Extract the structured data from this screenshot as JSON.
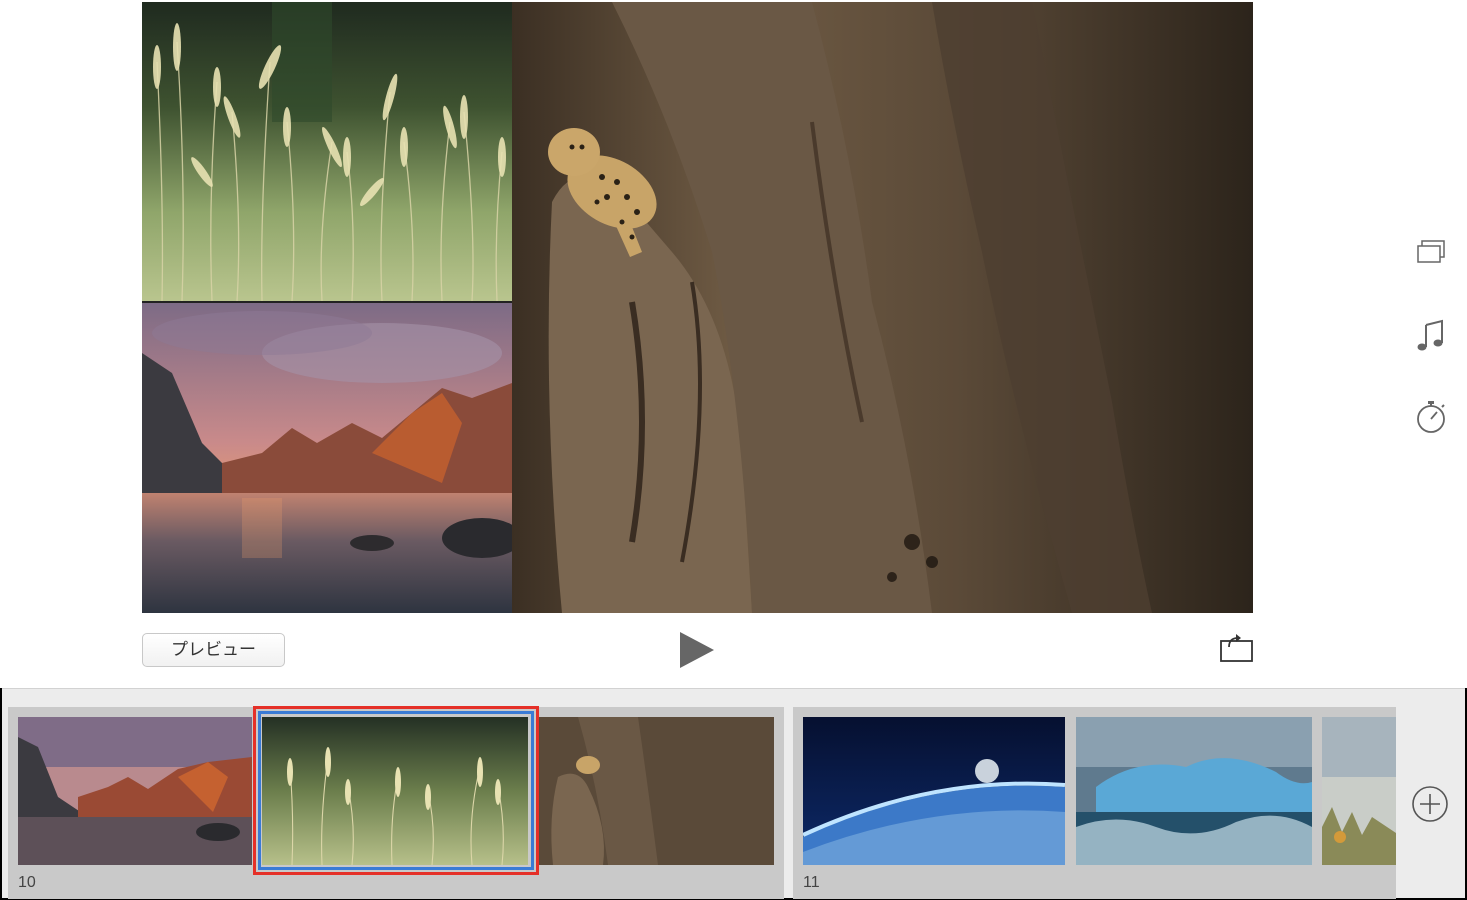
{
  "viewer": {
    "photos": [
      "grass-photo",
      "fjord-sunset-photo",
      "leopard-tree-photo"
    ],
    "preview_label": "プレビュー"
  },
  "side_tools": {
    "icons": [
      "theme-icon",
      "music-icon",
      "timer-icon"
    ]
  },
  "timeline": {
    "groups": [
      {
        "number": "10",
        "thumbs": [
          "fjord-sunset-thumb",
          "grass-thumb",
          "leopard-thumb"
        ],
        "selected_index": 1
      },
      {
        "number": "11",
        "thumbs": [
          "earth-moon-thumb",
          "iceberg-thumb",
          "misty-forest-thumb"
        ]
      }
    ]
  },
  "colors": {
    "selection_outer": "#e53028",
    "selection_inner": "#3a7bd5",
    "timeline_bg": "#ececec",
    "group_bg": "#c9c9c9"
  }
}
